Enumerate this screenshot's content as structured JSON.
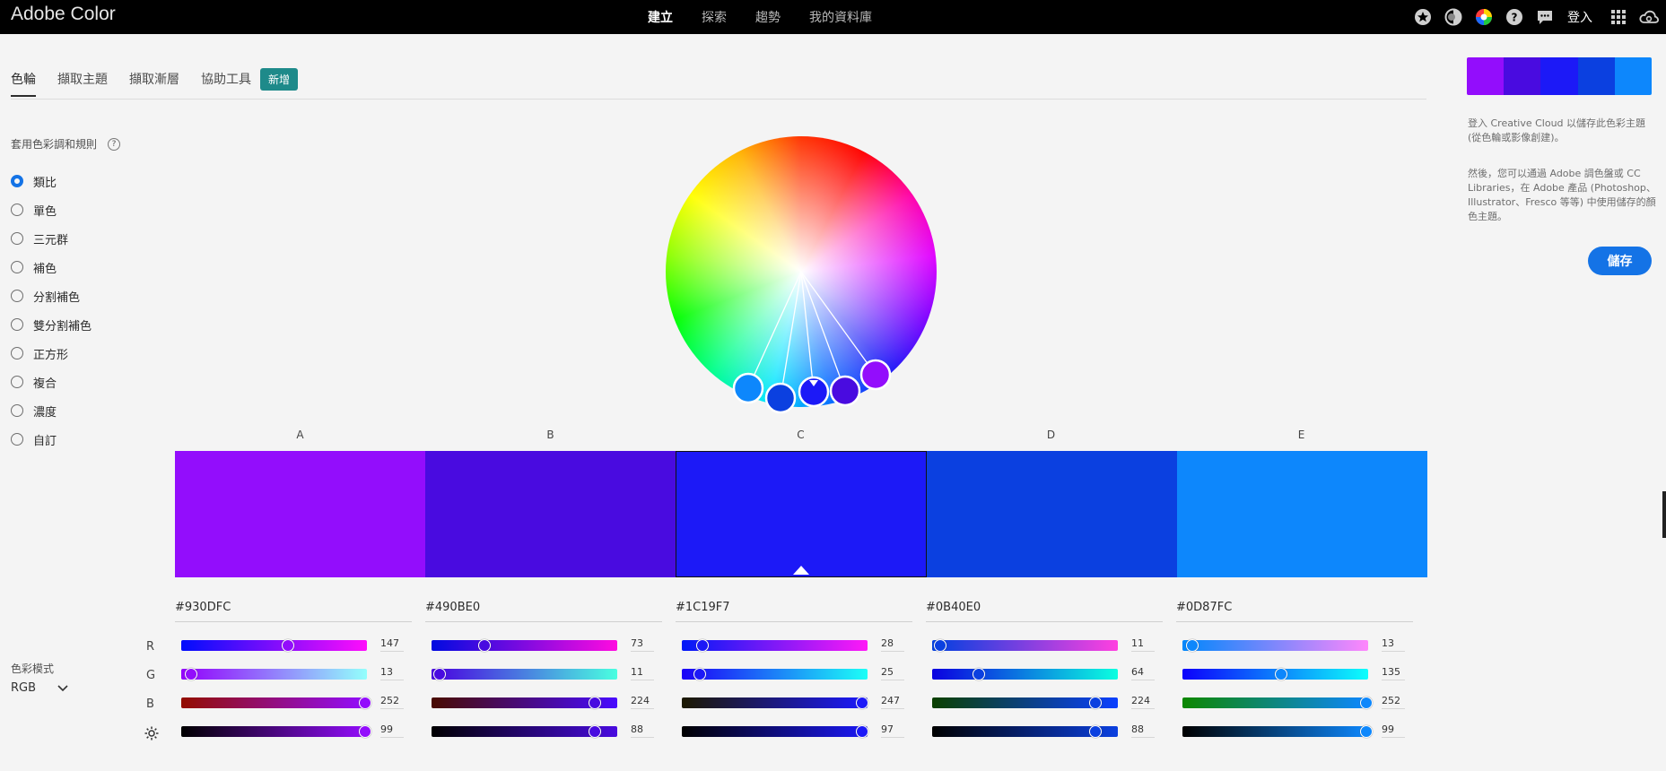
{
  "app": {
    "title": "Adobe Color"
  },
  "nav": {
    "items": [
      "建立",
      "探索",
      "趨勢",
      "我的資料庫"
    ],
    "active": 0
  },
  "topbar": {
    "signin_label": "登入",
    "icons": [
      "star-icon",
      "contrast-icon",
      "color-wheel-icon",
      "help-icon",
      "chat-icon",
      "apps-grid-icon",
      "creative-cloud-icon"
    ]
  },
  "tabs": {
    "items": [
      "色輪",
      "擷取主題",
      "擷取漸層",
      "協助工具"
    ],
    "active": 0,
    "new_badge": "新增"
  },
  "harmony": {
    "title": "套用色彩調和規則",
    "help_icon": "?",
    "rules": [
      "類比",
      "單色",
      "三元群",
      "補色",
      "分割補色",
      "雙分割補色",
      "正方形",
      "複合",
      "濃度",
      "自訂"
    ],
    "selected": 0
  },
  "theme": {
    "labels": [
      "A",
      "B",
      "C",
      "D",
      "E"
    ],
    "selected": 2,
    "swatches": [
      {
        "hex": "#930DFC",
        "r": 147,
        "g": 13,
        "b": 252,
        "brightness": 99
      },
      {
        "hex": "#490BE0",
        "r": 73,
        "g": 11,
        "b": 224,
        "brightness": 88
      },
      {
        "hex": "#1C19F7",
        "r": 28,
        "g": 25,
        "b": 247,
        "brightness": 97
      },
      {
        "hex": "#0B40E0",
        "r": 11,
        "g": 64,
        "b": 224,
        "brightness": 88
      },
      {
        "hex": "#0D87FC",
        "r": 13,
        "g": 135,
        "b": 252,
        "brightness": 99
      }
    ]
  },
  "channels": {
    "labels": [
      "R",
      "G",
      "B"
    ],
    "brightness_icon": "sun-icon"
  },
  "color_mode": {
    "title": "色彩模式",
    "value": "RGB"
  },
  "right_panel": {
    "info1": "登入 Creative Cloud 以儲存此色彩主題 (從色輪或影像創建)。",
    "info2": "然後，您可以通過 Adobe 調色盤或 CC Libraries，在 Adobe 產品 (Photoshop、Illustrator、Fresco 等等) 中使用儲存的顏色主題。",
    "save_label": "儲存"
  }
}
